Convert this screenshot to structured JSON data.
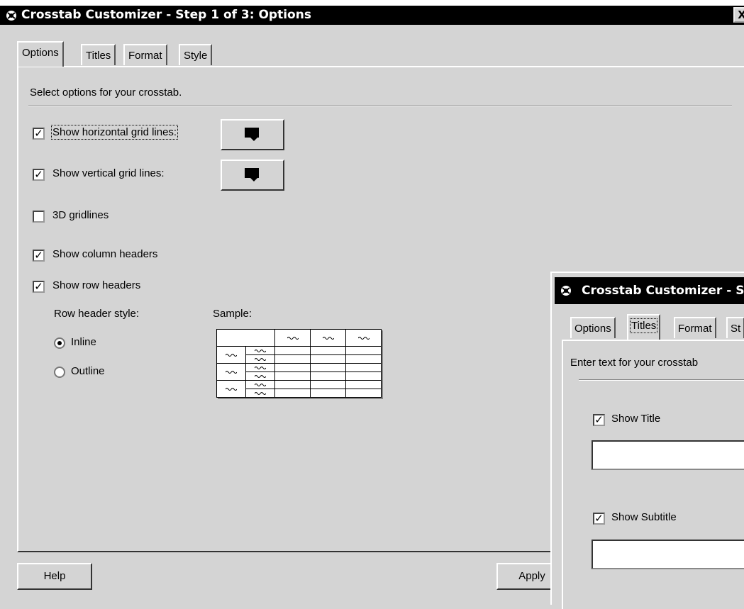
{
  "window": {
    "title": "Crosstab Customizer - Step 1 of 3: Options",
    "close_label": "X"
  },
  "tabs": [
    {
      "label": "Options"
    },
    {
      "label": "Titles"
    },
    {
      "label": "Format"
    },
    {
      "label": "Style"
    }
  ],
  "options": {
    "instruction": "Select options for your crosstab.",
    "horizontal_grid": {
      "label": "Show horizontal grid lines:",
      "checked": true
    },
    "vertical_grid": {
      "label": "Show vertical grid lines:",
      "checked": true
    },
    "gridlines_3d": {
      "label": "3D gridlines",
      "checked": false
    },
    "column_headers": {
      "label": "Show column headers",
      "checked": true
    },
    "row_headers": {
      "label": "Show row headers",
      "checked": true
    },
    "row_header_style_label": "Row header style:",
    "sample_label": "Sample:",
    "inline_label": "Inline",
    "outline_label": "Outline",
    "selected_style": "Inline"
  },
  "buttons": {
    "help": "Help",
    "apply": "Apply"
  },
  "dialog2": {
    "title": "Crosstab Customizer - S",
    "tabs": [
      {
        "label": "Options"
      },
      {
        "label": "Titles"
      },
      {
        "label": "Format"
      },
      {
        "label": "St"
      }
    ],
    "instruction": "Enter text for your crosstab",
    "show_title": {
      "label": "Show Title",
      "checked": true
    },
    "show_subtitle": {
      "label": "Show Subtitle",
      "checked": true
    },
    "title_value": "",
    "subtitle_value": ""
  },
  "colors": {
    "titlebar": "#000000",
    "dialog_bg": "#d4d4d4"
  }
}
